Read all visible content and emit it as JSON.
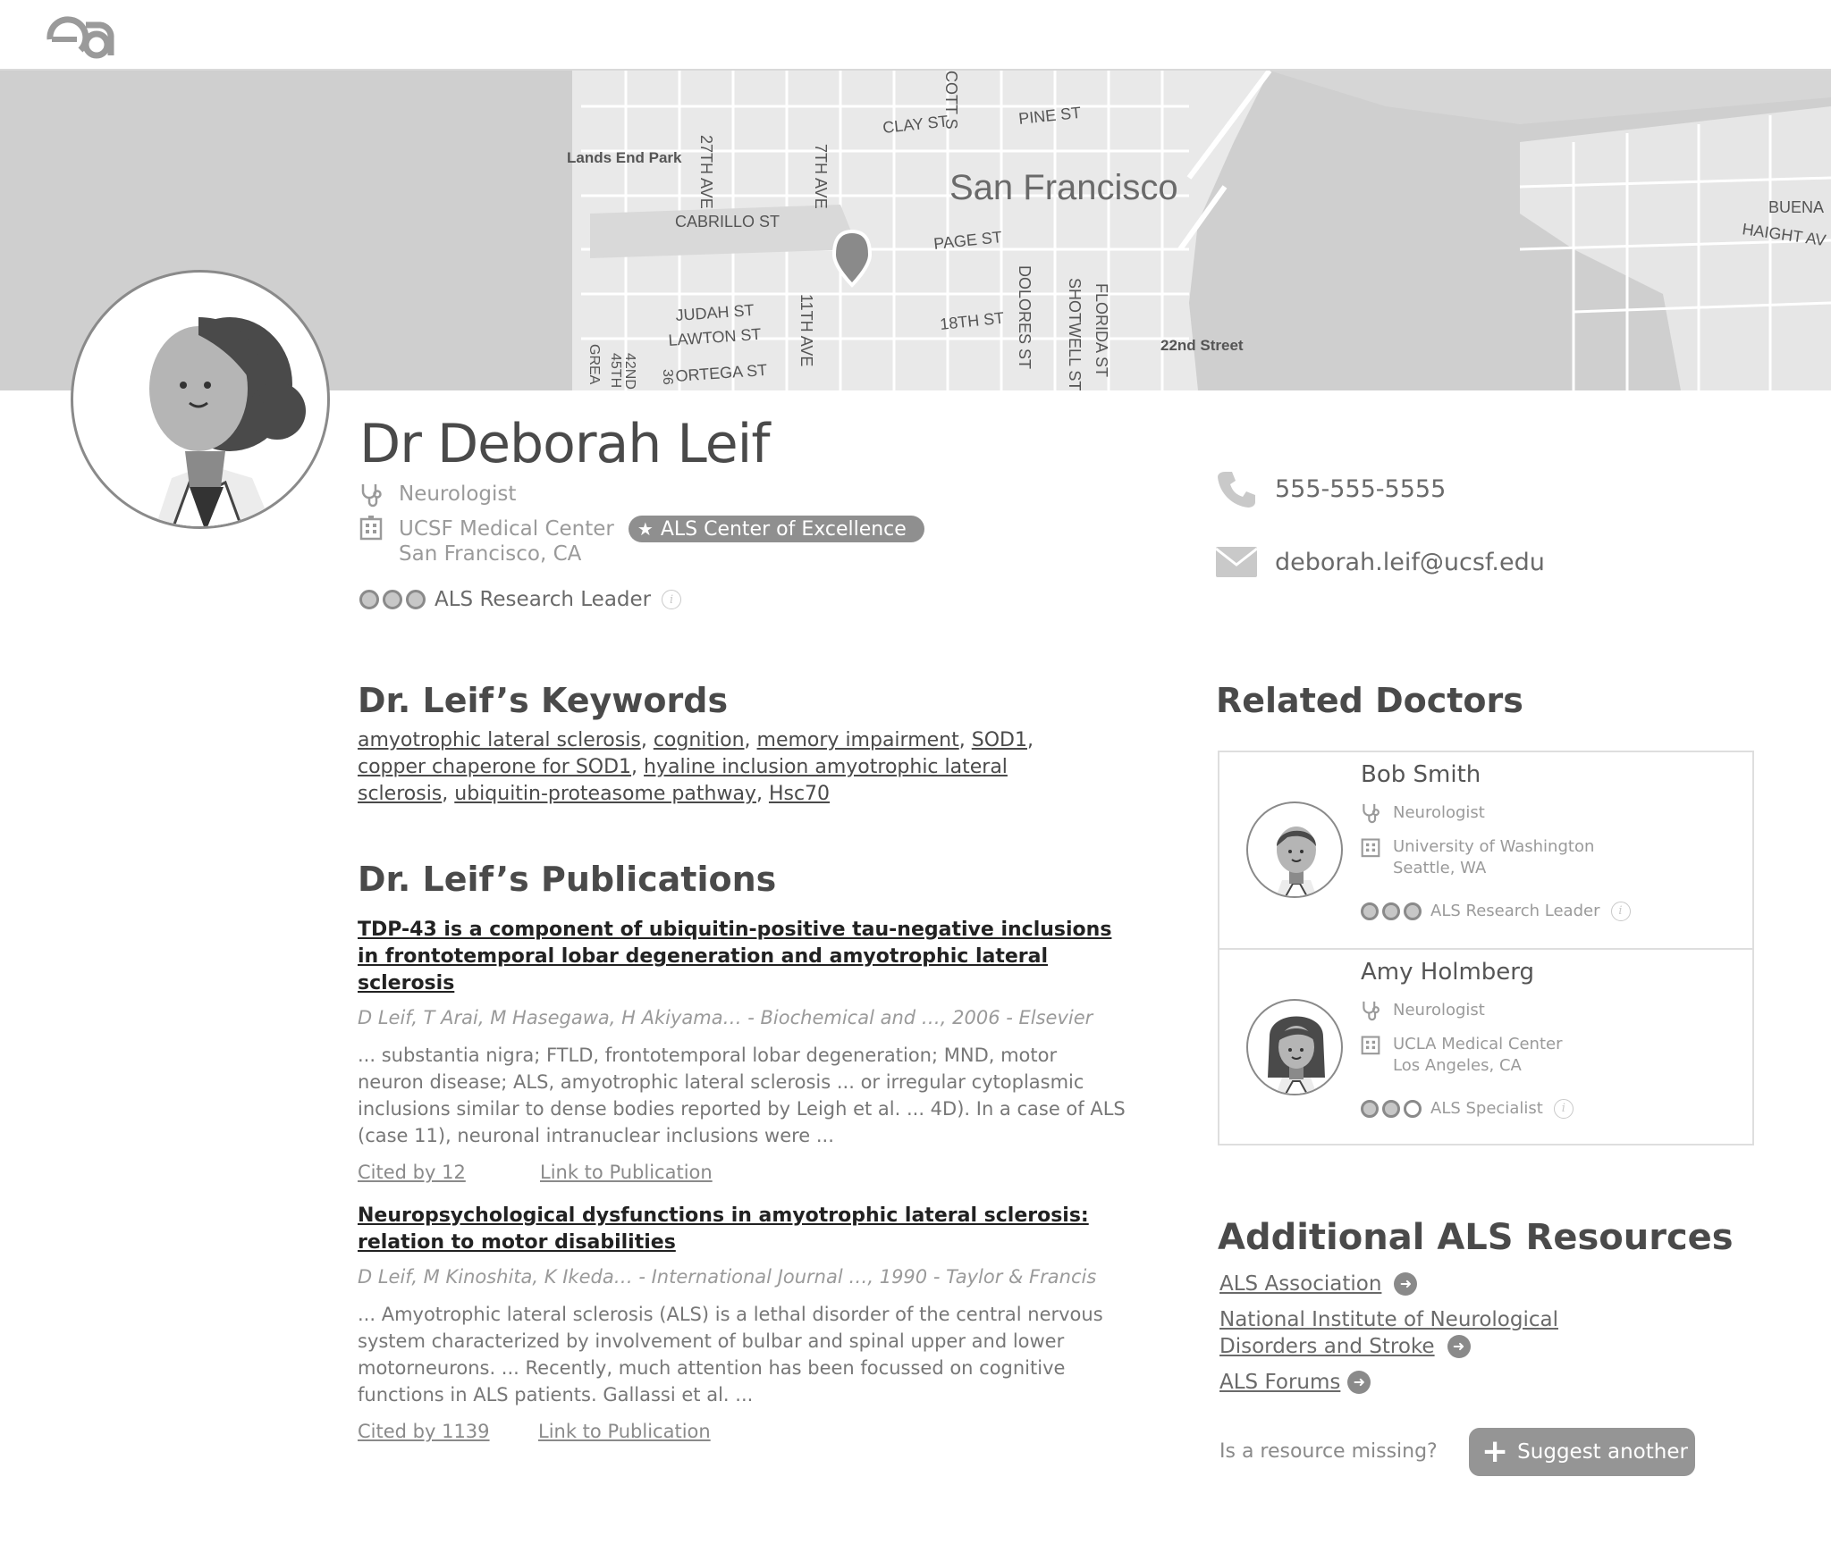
{
  "header": {
    "logo": "ea-logo-icon"
  },
  "map": {
    "city": "San Francisco",
    "labels": [
      "Lands End Park",
      "27TH AVE",
      "7TH AVE",
      "CLAY ST",
      "PINE ST",
      "CABRILLO ST",
      "PAGE ST",
      "JUDAH ST",
      "LAWTON ST",
      "ORTEGA ST",
      "11TH AVE",
      "18TH ST",
      "DOLORES ST",
      "SHOTWELL ST",
      "FLORIDA ST",
      "22nd Street",
      "BUENA",
      "HAIGHT AV",
      "COTT S",
      "42ND",
      "45TH",
      "GREA",
      "36"
    ]
  },
  "profile": {
    "name": "Dr Deborah Leif",
    "specialty": "Neurologist",
    "institution": "UCSF Medical Center",
    "location": "San Francisco, CA",
    "badge": "ALS Center of Excellence",
    "rank_label": "ALS Research Leader",
    "phone": "555-555-5555",
    "email": "deborah.leif@ucsf.edu"
  },
  "keywords": {
    "heading": "Dr. Leif’s Keywords",
    "items": [
      "amyotrophic lateral sclerosis",
      "cognition",
      "memory impairment",
      "SOD1",
      "copper chaperone for SOD1",
      "hyaline inclusion amyotrophic lateral sclerosis",
      "ubiquitin-proteasome pathway",
      "Hsc70"
    ]
  },
  "publications": {
    "heading": "Dr. Leif’s Publications",
    "items": [
      {
        "title": "TDP-43 is a component of ubiquitin-positive tau-negative inclusions in frontotemporal lobar degeneration and amyotrophic lateral sclerosis",
        "authors": "D Leif, T Arai, M Hasegawa, H Akiyama… - Biochemical and …, 2006 - Elsevier",
        "snippet": "... substantia nigra; FTLD, frontotemporal lobar degeneration; MND, motor neuron disease; ALS, amyotrophic lateral sclerosis ... or irregular cytoplasmic inclusions similar to dense bodies reported by Leigh et al. ... 4D). In a case of ALS (case 11), neuronal intranuclear inclusions were ...",
        "cited": "Cited by 12",
        "link": "Link to Publication"
      },
      {
        "title": "Neuropsychological dysfunctions in amyotrophic lateral sclerosis: relation to motor disabilities",
        "authors": "D Leif, M Kinoshita, K Ikeda… - International Journal …, 1990 - Taylor & Francis",
        "snippet": "... Amyotrophic lateral sclerosis (ALS) is a lethal disorder of the central nervous system characterized by involvement of bulbar and spinal upper and lower motorneurons. ... Recently, much attention has been focussed on cognitive functions in ALS patients. Gallassi et al. ...",
        "cited": "Cited by 1139",
        "link": "Link to Publication"
      }
    ]
  },
  "related": {
    "heading": "Related Doctors",
    "doctors": [
      {
        "name": "Bob Smith",
        "specialty": "Neurologist",
        "institution": "University of Washington",
        "location": "Seattle, WA",
        "rank_label": "ALS Research Leader",
        "rank_dots": 3
      },
      {
        "name": "Amy Holmberg",
        "specialty": "Neurologist",
        "institution": "UCLA Medical Center",
        "location": "Los Angeles, CA",
        "rank_label": "ALS Specialist",
        "rank_dots": 2
      }
    ]
  },
  "resources": {
    "heading": "Additional ALS Resources",
    "links": [
      "ALS Association",
      "National Institute of Neurological",
      "Disorders and Stroke",
      "ALS Forums"
    ],
    "missing_text": "Is a resource missing?",
    "suggest_label": "Suggest another"
  },
  "colors": {
    "accent_gray": "#8f8f8f",
    "map_bg": "#cfcfcf",
    "text_dark": "#4a4a4a"
  }
}
